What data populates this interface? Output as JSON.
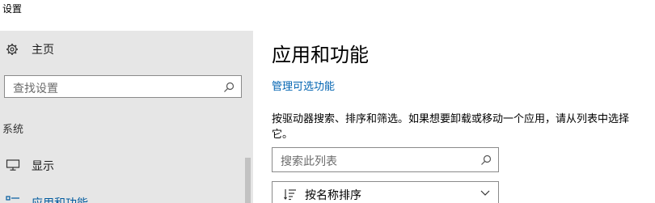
{
  "window": {
    "title": "设置"
  },
  "sidebar": {
    "home_label": "主页",
    "search_placeholder": "查找设置",
    "section_label": "系统",
    "items": [
      {
        "label": "显示",
        "icon": "monitor-icon"
      },
      {
        "label": "应用和功能",
        "icon": "apps-list-icon"
      }
    ]
  },
  "main": {
    "title": "应用和功能",
    "manage_link": "管理可选功能",
    "description": "按驱动器搜索、排序和筛选。如果想要卸载或移动一个应用，请从列表中选择它。",
    "list_search_placeholder": "搜索此列表",
    "sort_label": "按名称排序"
  },
  "colors": {
    "sidebar_bg": "#e6e6e6",
    "accent": "#0063b1",
    "selected_text": "#005a9e"
  }
}
